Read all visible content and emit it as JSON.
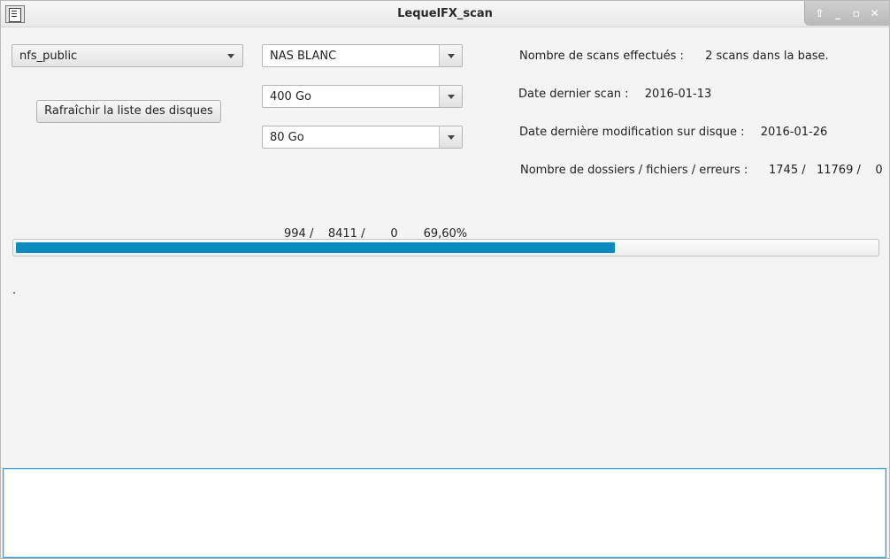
{
  "window": {
    "title": "LequelFX_scan",
    "controls": [
      "restore-up",
      "minimize",
      "maximize",
      "close"
    ]
  },
  "left": {
    "share_combo": {
      "value": "nfs_public"
    },
    "refresh_button": "Rafraîchir la liste des disques"
  },
  "middle": {
    "nas_combo": {
      "value": "NAS BLANC"
    },
    "size1_combo": {
      "value": "400 Go"
    },
    "size2_combo": {
      "value": "80 Go"
    }
  },
  "info": {
    "scans_label": "Nombre de scans effectués :",
    "scans_value": "2 scans dans la base.",
    "last_scan_label": "Date dernier scan :",
    "last_scan_value": "2016-01-13",
    "last_mod_label": "Date dernière modification sur disque :",
    "last_mod_value": "2016-01-26",
    "counts_label": "Nombre de dossiers / fichiers / erreurs :",
    "counts_value": "1745 /   11769 /    0"
  },
  "progress": {
    "label": "994 /    8411 /       0       69,60%",
    "fraction": 0.696,
    "color": "#0a8bbf"
  },
  "status_text": ".",
  "log_area": {
    "value": ""
  }
}
